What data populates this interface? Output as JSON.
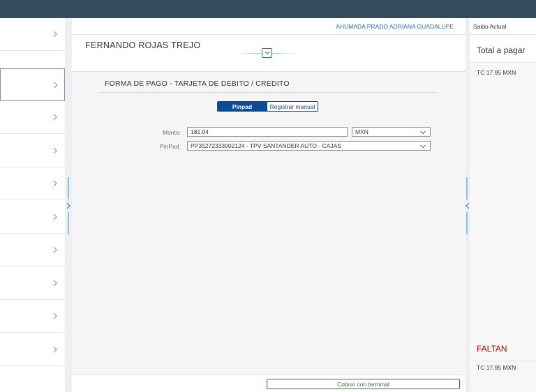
{
  "header": {
    "user_name": "AHUMADA PRADO ADRIANA GUADALUPE"
  },
  "customer": {
    "name": "FERNANDO ROJAS TREJO"
  },
  "payment": {
    "section_title": "FORMA DE PAGO - TARJETA DE DEBITO / CREDITO",
    "mode_tabs": [
      {
        "label": "Pinpad",
        "selected": true
      },
      {
        "label": "Registrar manual",
        "selected": false
      }
    ],
    "monto_label": "Monto:",
    "monto_value": "181.04",
    "currency_value": "MXN",
    "pinpad_label": "PinPad:",
    "pinpad_value": "PP35272333002124 - TPV SANTANDER AUTO - CAJAS"
  },
  "footer": {
    "charge_button": "Cobrar con terminal"
  },
  "summary": {
    "saldo_label": "Saldo Actual",
    "total_label": "Total a pagar",
    "tc_top": "TC 17.95 MXN",
    "faltan_label": "FALTAN",
    "tc_bottom": "TC 17.95 MXN"
  },
  "icons": {
    "list_chevron": "chevron-right-icon",
    "collapse": "chevron-down-icon",
    "dropdown": "chevron-down-icon",
    "splitter_left": "chevron-right-icon",
    "splitter_right": "chevron-left-icon"
  },
  "colors": {
    "shell_bar": "#354a5f",
    "primary": "#0a4d95",
    "link": "#2a6bb0",
    "success": "#2b7c2b",
    "negative": "#bb0000"
  }
}
